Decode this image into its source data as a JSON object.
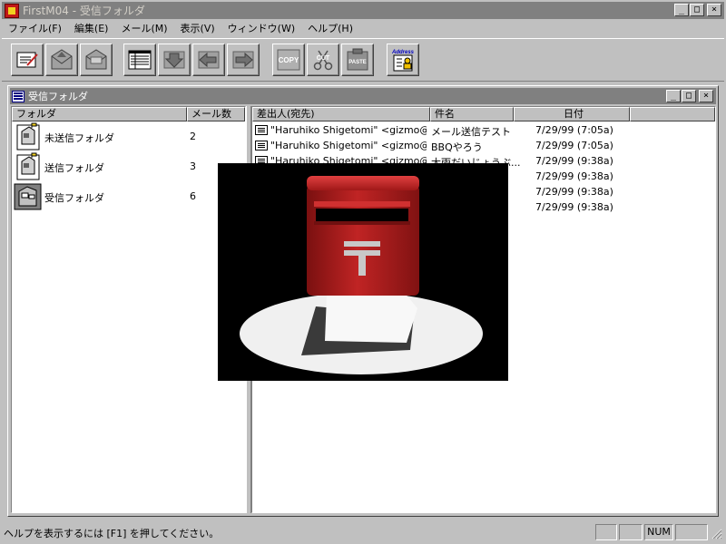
{
  "window": {
    "title": "FirstM04 - 受信フォルダ",
    "caption_buttons": {
      "minimize": "_",
      "maximize": "□",
      "close": "×"
    }
  },
  "menu": [
    {
      "label": "ファイル(F)"
    },
    {
      "label": "編集(E)"
    },
    {
      "label": "メール(M)"
    },
    {
      "label": "表示(V)"
    },
    {
      "label": "ウィンドウ(W)"
    },
    {
      "label": "ヘルプ(H)"
    }
  ],
  "toolbar": {
    "buttons": [
      {
        "icon": "compose-icon"
      },
      {
        "icon": "send-mail-icon"
      },
      {
        "icon": "receive-mail-icon"
      },
      {
        "icon": "list-view-icon"
      },
      {
        "icon": "download-icon"
      },
      {
        "icon": "reply-icon"
      },
      {
        "icon": "forward-icon"
      },
      {
        "icon": "copy-icon"
      },
      {
        "icon": "cut-icon"
      },
      {
        "icon": "paste-icon"
      },
      {
        "icon": "address-book-icon"
      }
    ],
    "copy_label": "COPY",
    "cut_label": "CUT",
    "paste_label": "PASTE",
    "address_label": "Address"
  },
  "inner_window": {
    "title": "受信フォルダ",
    "caption_buttons": {
      "minimize": "_",
      "maximize": "□",
      "close": "×"
    }
  },
  "folder_pane": {
    "headers": {
      "folder": "フォルダ",
      "count": "メール数"
    },
    "folders": [
      {
        "name": "未送信フォルダ",
        "count": "2",
        "icon": "outbox-mailbox-icon"
      },
      {
        "name": "送信フォルダ",
        "count": "3",
        "icon": "sent-mailbox-icon"
      },
      {
        "name": "受信フォルダ",
        "count": "6",
        "icon": "inbox-mailbox-icon"
      }
    ]
  },
  "message_pane": {
    "headers": {
      "sender": "差出人(宛先)",
      "subject": "件名",
      "date": "日付"
    },
    "messages": [
      {
        "sender": "\"Haruhiko Shigetomi\" <gizmo@t...",
        "subject": "メール送信テスト",
        "date": "7/29/99 (7:05a)"
      },
      {
        "sender": "\"Haruhiko Shigetomi\" <gizmo@t...",
        "subject": "BBQやろう",
        "date": "7/29/99 (7:05a)"
      },
      {
        "sender": "\"Haruhiko Shigetomi\" <gizmo@t...",
        "subject": "大雨だいじょうぶ...",
        "date": "7/29/99 (9:38a)"
      },
      {
        "sender": "",
        "subject": "",
        "date": "7/29/99 (9:38a)"
      },
      {
        "sender": "",
        "subject": "",
        "date": "7/29/99 (9:38a)"
      },
      {
        "sender": "",
        "subject": "",
        "date": "7/29/99 (9:38a)"
      }
    ]
  },
  "splash": {
    "image": "red-postbox-image"
  },
  "statusbar": {
    "text": "ヘルプを表示するには [F1] を押してください。",
    "panels": [
      "",
      "",
      "NUM",
      ""
    ]
  },
  "colors": {
    "face": "#c0c0c0",
    "title_inactive": "#808080",
    "postbox_red": "#b01c1c"
  }
}
